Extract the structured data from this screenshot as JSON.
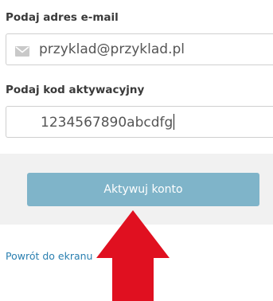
{
  "form": {
    "email_label": "Podaj adres e-mail",
    "email_value": "przyklad@przyklad.pl",
    "email_icon": "envelope-icon",
    "code_label": "Podaj kod aktywacyjny",
    "code_value": "1234567890abcdfg",
    "submit_label": "Aktywuj konto",
    "back_link": "Powrót do ekranu"
  },
  "colors": {
    "button": "#7fb4c9",
    "panel": "#f1f1f1",
    "link": "#2a7fb0",
    "arrow": "#e01020"
  }
}
